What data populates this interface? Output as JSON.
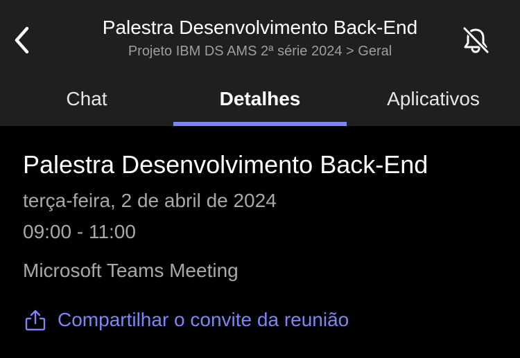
{
  "header": {
    "title": "Palestra Desenvolvimento Back-End",
    "subtitle": "Projeto IBM DS AMS 2ª série 2024 > Geral",
    "back_icon": "chevron-left-icon",
    "notification_icon": "bell-off-icon"
  },
  "tabs": [
    {
      "label": "Chat",
      "active": false
    },
    {
      "label": "Detalhes",
      "active": true
    },
    {
      "label": "Aplicativos",
      "active": false
    }
  ],
  "details": {
    "title": "Palestra Desenvolvimento Back-End",
    "date": "terça-feira, 2 de abril de 2024",
    "time": "09:00 - 11:00",
    "meeting_type": "Microsoft Teams Meeting",
    "share_label": "Compartilhar o convite da reunião",
    "share_icon": "share-icon"
  },
  "colors": {
    "accent": "#7f85f5",
    "header_bg": "#1f1f1f",
    "background": "#000000",
    "secondary_text": "#a9a9a9"
  }
}
